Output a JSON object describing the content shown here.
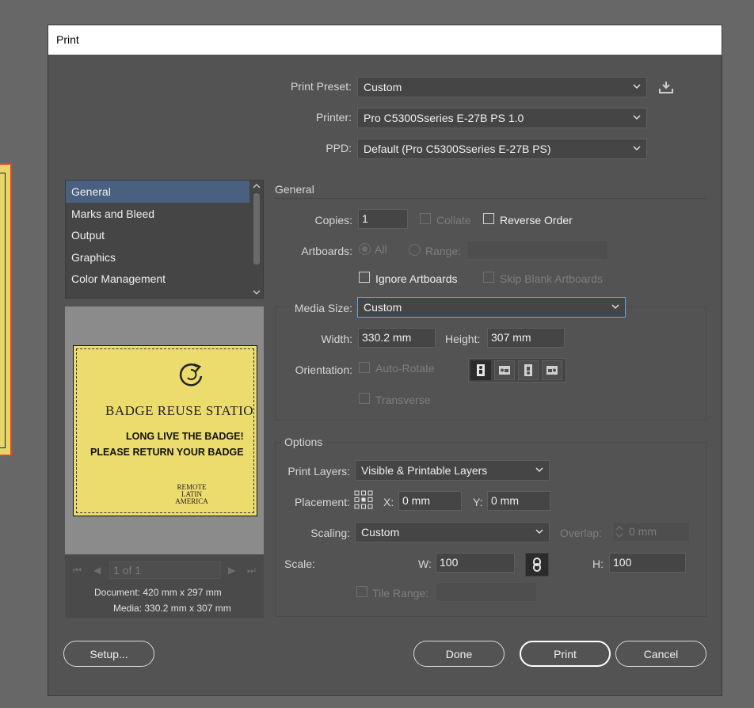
{
  "window": {
    "title": "Print"
  },
  "preset": {
    "label": "Print Preset:",
    "value": "Custom",
    "save_icon": "save-preset-icon"
  },
  "printer": {
    "label": "Printer:",
    "value": "Pro C5300Sseries E-27B PS 1.0"
  },
  "ppd": {
    "label": "PPD:",
    "value": "Default (Pro C5300Sseries E-27B PS)"
  },
  "sidebar": {
    "items": [
      {
        "label": "General"
      },
      {
        "label": "Marks and Bleed"
      },
      {
        "label": "Output"
      },
      {
        "label": "Graphics"
      },
      {
        "label": "Color Management"
      }
    ]
  },
  "general": {
    "title": "General",
    "copies_label": "Copies:",
    "copies_value": "1",
    "collate_label": "Collate",
    "reverse_label": "Reverse Order",
    "artboards_label": "Artboards:",
    "all_label": "All",
    "range_label": "Range:",
    "ignore_artboards_label": "Ignore Artboards",
    "skip_blank_label": "Skip Blank Artboards",
    "media_size_label": "Media Size:",
    "media_size_value": "Custom",
    "width_label": "Width:",
    "width_value": "330.2 mm",
    "height_label": "Height:",
    "height_value": "307 mm",
    "orientation_label": "Orientation:",
    "auto_rotate_label": "Auto-Rotate",
    "transverse_label": "Transverse"
  },
  "options": {
    "title": "Options",
    "print_layers_label": "Print Layers:",
    "print_layers_value": "Visible & Printable Layers",
    "placement_label": "Placement:",
    "x_label": "X:",
    "x_value": "0 mm",
    "y_label": "Y:",
    "y_value": "0 mm",
    "scaling_label": "Scaling:",
    "scaling_value": "Custom",
    "overlap_label": "Overlap:",
    "overlap_value": "0 mm",
    "scale_label": "Scale:",
    "w_label": "W:",
    "w_value": "100",
    "h_label": "H:",
    "h_value": "100",
    "tile_range_label": "Tile Range:"
  },
  "preview": {
    "badge_title": "BADGE REUSE STATIO",
    "badge_line1": "LONG LIVE THE BADGE!",
    "badge_line2": "PLEASE RETURN YOUR BADGE",
    "logo_line1": "REMOTE",
    "logo_line2": "LATIN",
    "logo_line3": "AMERICA",
    "page_indicator": "1 of 1",
    "document_label": "Document: 420 mm x 297 mm",
    "media_label": "Media: 330.2 mm x 307 mm"
  },
  "buttons": {
    "setup": "Setup...",
    "done": "Done",
    "print": "Print",
    "cancel": "Cancel"
  }
}
